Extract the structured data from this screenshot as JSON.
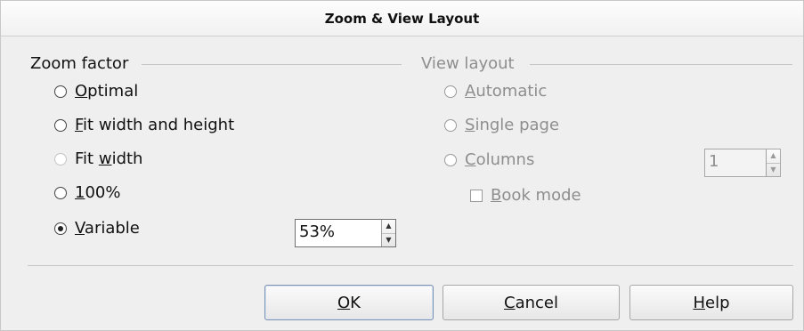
{
  "dialog": {
    "title": "Zoom & View Layout"
  },
  "zoom_factor": {
    "label": "Zoom factor",
    "options": [
      {
        "mnemonic": "O",
        "rest": "ptimal",
        "selected": false
      },
      {
        "mnemonic": "F",
        "rest": "it width and height",
        "selected": false
      },
      {
        "pre": "Fit ",
        "mnemonic": "w",
        "rest": "idth",
        "selected": false
      },
      {
        "mnemonic": "1",
        "rest": "00%",
        "selected": false
      },
      {
        "mnemonic": "V",
        "rest": "ariable",
        "selected": true
      }
    ],
    "variable_value": "53%"
  },
  "view_layout": {
    "label": "View layout",
    "options": [
      {
        "mnemonic": "A",
        "rest": "utomatic"
      },
      {
        "mnemonic": "S",
        "rest": "ingle page"
      },
      {
        "mnemonic": "C",
        "rest": "olumns"
      }
    ],
    "columns_value": "1",
    "book_mode": {
      "mnemonic": "B",
      "rest": "ook mode",
      "checked": false
    }
  },
  "buttons": {
    "ok": {
      "mnemonic": "O",
      "rest": "K"
    },
    "cancel": {
      "mnemonic": "C",
      "rest": "ancel"
    },
    "help": {
      "mnemonic": "H",
      "rest": "elp"
    }
  }
}
